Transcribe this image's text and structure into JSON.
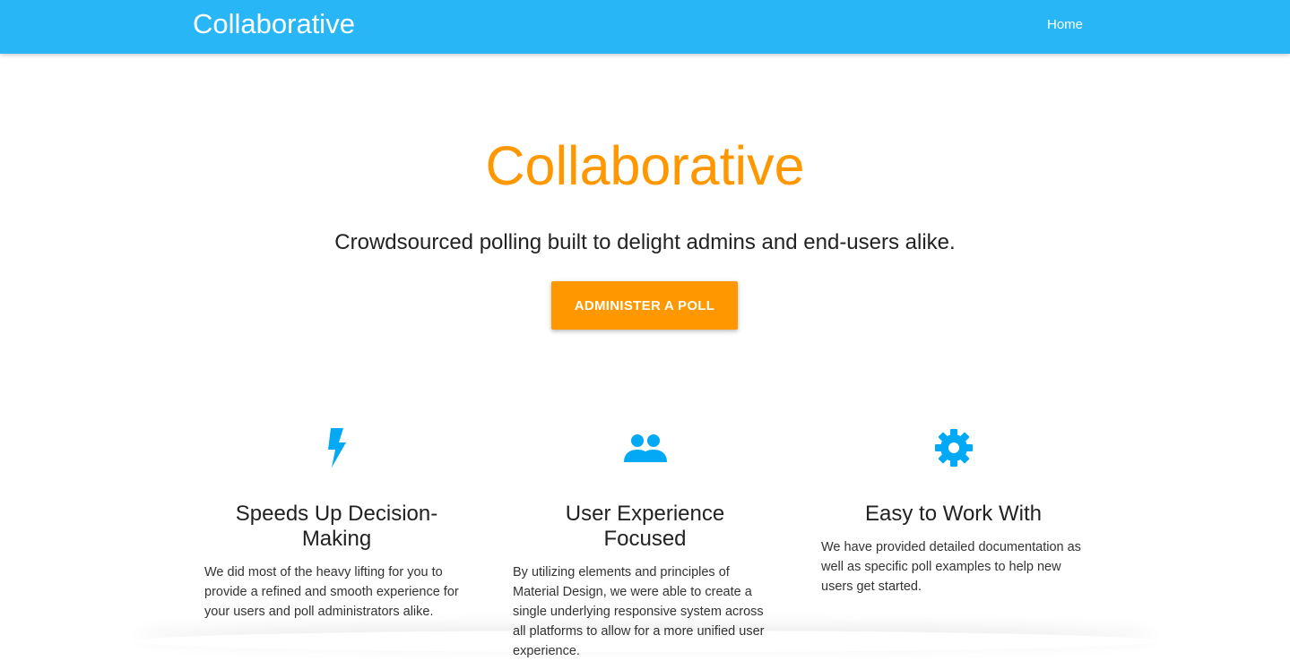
{
  "navbar": {
    "brand": "Collaborative",
    "links": [
      "Home"
    ]
  },
  "hero": {
    "title": "Collaborative",
    "subtitle": "Crowdsourced polling built to delight admins and end-users alike.",
    "cta_label": "ADMINISTER A POLL"
  },
  "features": [
    {
      "icon": "lightning-bolt-icon",
      "title": "Speeds Up Decision-Making",
      "text": "We did most of the heavy lifting for you to provide a refined and smooth experience for your users and poll administrators alike."
    },
    {
      "icon": "users-group-icon",
      "title": "User Experience Focused",
      "text": "By utilizing elements and principles of Material Design, we were able to create a single underlying responsive system across all platforms to allow for a more unified user experience."
    },
    {
      "icon": "gear-icon",
      "title": "Easy to Work With",
      "text": "We have provided detailed documentation as well as specific poll examples to help new users get started."
    }
  ],
  "colors": {
    "navbar": "#29b6f6",
    "accent": "#ff9800",
    "icon": "#03a9f4"
  }
}
